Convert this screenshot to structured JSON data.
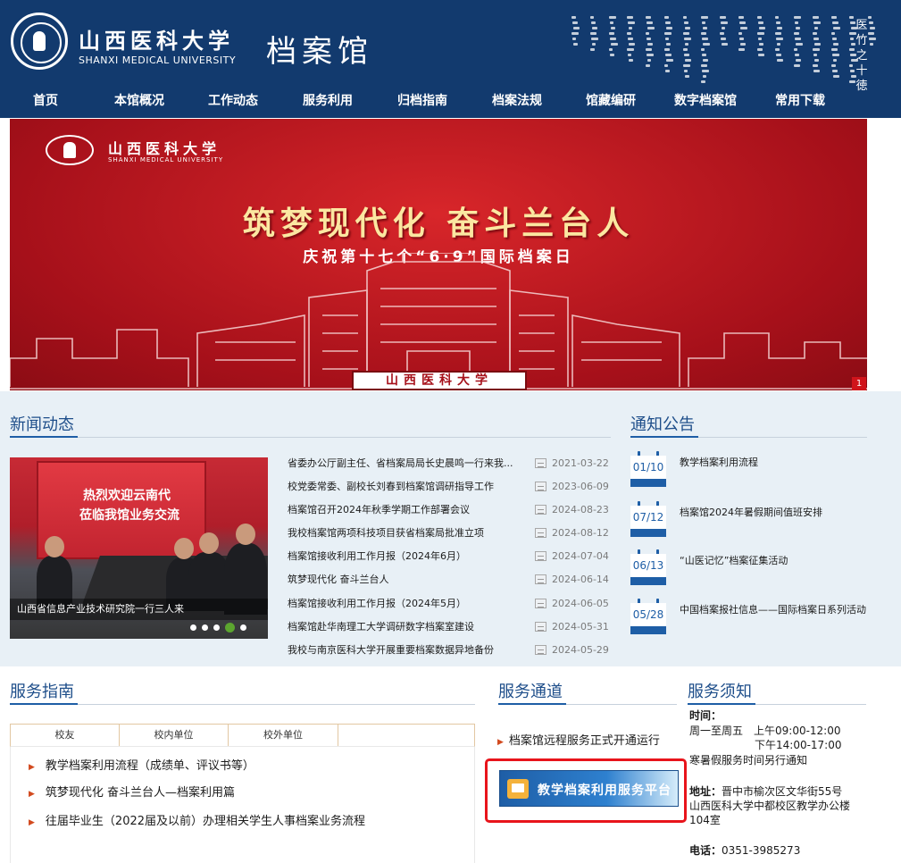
{
  "header": {
    "univ_cn": "山西医科大学",
    "univ_en": "SHANXI MEDICAL UNIVERSITY",
    "archive_title": "档案馆",
    "motto": "医竹之十徳"
  },
  "nav": [
    "首页",
    "本馆概况",
    "工作动态",
    "服务利用",
    "归档指南",
    "档案法规",
    "馆藏编研",
    "数字档案馆",
    "常用下载"
  ],
  "banner": {
    "univ_cn": "山西医科大学",
    "univ_en": "SHANXI MEDICAL UNIVERSITY",
    "title": "筑梦现代化 奋斗兰台人",
    "subtitle": "庆祝第十七个“6·9”国际档案日",
    "plaque": "山西医科大学",
    "index": "1"
  },
  "news": {
    "title": "新闻动态",
    "photo": {
      "screen_line1": "热烈欢迎云南代",
      "screen_line2": "莅临我馆业务交流",
      "caption": "山西省信息产业技术研究院一行三人来"
    },
    "items": [
      {
        "title": "省委办公厅副主任、省档案局局长史晨鸣一行来我...",
        "date": "2021-03-22"
      },
      {
        "title": "校党委常委、副校长刘春到档案馆调研指导工作",
        "date": "2023-06-09"
      },
      {
        "title": "档案馆召开2024年秋季学期工作部署会议",
        "date": "2024-08-23"
      },
      {
        "title": "我校档案馆两项科技项目获省档案局批准立项",
        "date": "2024-08-12"
      },
      {
        "title": "档案馆接收利用工作月报（2024年6月）",
        "date": "2024-07-04"
      },
      {
        "title": "筑梦现代化 奋斗兰台人",
        "date": "2024-06-14"
      },
      {
        "title": "档案馆接收利用工作月报（2024年5月）",
        "date": "2024-06-05"
      },
      {
        "title": "档案馆赴华南理工大学调研数字档案室建设",
        "date": "2024-05-31"
      },
      {
        "title": "我校与南京医科大学开展重要档案数据异地备份",
        "date": "2024-05-29"
      }
    ]
  },
  "notices": {
    "title": "通知公告",
    "items": [
      {
        "date": "01/10",
        "title": "教学档案利用流程"
      },
      {
        "date": "07/12",
        "title": "档案馆2024年暑假期间值班安排"
      },
      {
        "date": "06/13",
        "title": "“山医记忆”档案征集活动"
      },
      {
        "date": "05/28",
        "title": "中国档案报社信息——国际档案日系列活动"
      }
    ]
  },
  "guide": {
    "title": "服务指南",
    "tabs": [
      "校友",
      "校内单位",
      "校外单位"
    ],
    "items": [
      "教学档案利用流程（成绩单、评议书等）",
      "筑梦现代化 奋斗兰台人—档案利用篇",
      "往届毕业生（2022届及以前）办理相关学生人事档案业务流程"
    ]
  },
  "channel": {
    "title": "服务通道",
    "link": "档案馆远程服务正式开通运行",
    "platform": "教学档案利用服务平台"
  },
  "info": {
    "title": "服务须知",
    "time_label": "时间：",
    "time_line1": "周一至周五　上午09:00-12:00",
    "time_line2": "下午14:00-17:00",
    "time_line3": "寒暑假服务时间另行通知",
    "address_label": "地址：",
    "address_line1": "晋中市榆次区文华街55号",
    "address_line2": "山西医科大学中都校区教学办公楼",
    "address_line3": "104室",
    "phone_label": "电话：",
    "phone": "0351-3985273"
  }
}
